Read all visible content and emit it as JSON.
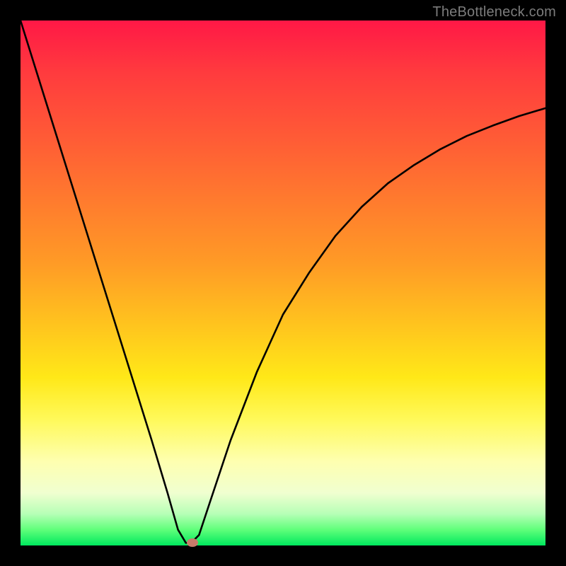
{
  "watermark": "TheBottleneck.com",
  "chart_data": {
    "type": "line",
    "title": "",
    "xlabel": "",
    "ylabel": "",
    "xlim": [
      0,
      100
    ],
    "ylim": [
      0,
      100
    ],
    "grid": false,
    "legend": false,
    "series": [
      {
        "name": "bottleneck-curve",
        "x": [
          0,
          5,
          10,
          15,
          20,
          25,
          28,
          30,
          31.5,
          32.5,
          34,
          36,
          40,
          45,
          50,
          55,
          60,
          65,
          70,
          75,
          80,
          85,
          90,
          95,
          100
        ],
        "values": [
          100,
          84,
          68,
          52,
          36,
          20,
          10,
          3,
          0.5,
          0.5,
          2,
          8,
          20,
          33,
          44,
          52,
          59,
          64.5,
          69,
          72.5,
          75.5,
          78,
          80,
          81.8,
          83.3
        ]
      }
    ],
    "marker": {
      "x": 32.8,
      "y": 0.6,
      "color": "#c77a6a"
    },
    "background_gradient": {
      "top": "#ff1846",
      "bottom": "#00e85e"
    }
  }
}
